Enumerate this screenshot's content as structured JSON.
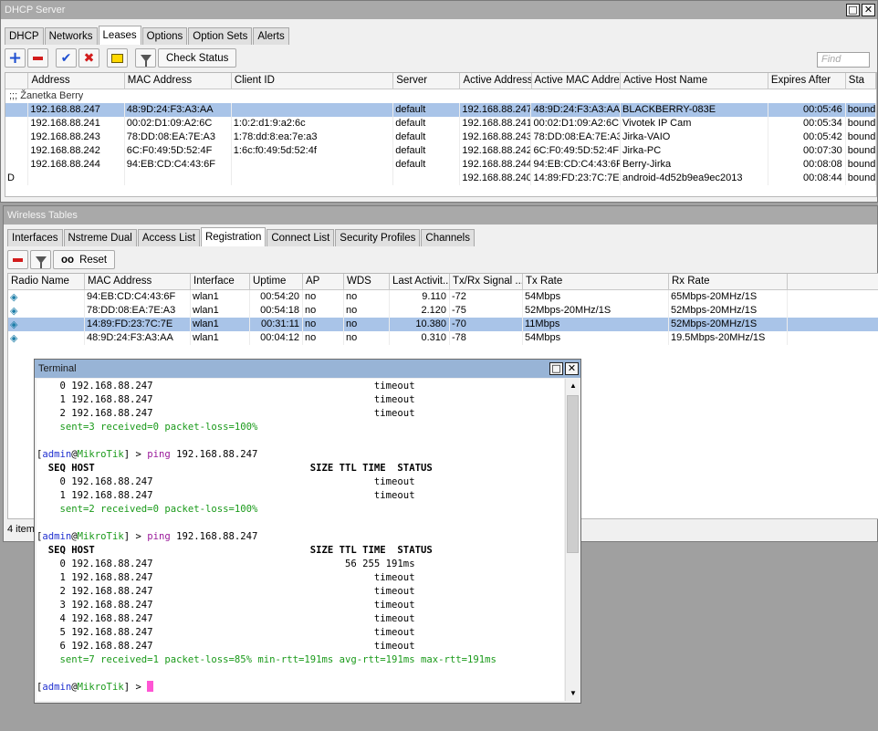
{
  "dhcp": {
    "title": "DHCP Server",
    "tabs": [
      "DHCP",
      "Networks",
      "Leases",
      "Options",
      "Option Sets",
      "Alerts"
    ],
    "selected_tab": "Leases",
    "check_status_label": "Check Status",
    "find_placeholder": "Find",
    "columns": [
      "Address",
      "MAC Address",
      "Client ID",
      "Server",
      "Active Address",
      "Active MAC Addre...",
      "Active Host Name",
      "Expires After",
      "Sta"
    ],
    "group_label": ";;; Žanetka Berry",
    "rows": [
      {
        "flag": "",
        "address": "192.168.88.247",
        "mac": "48:9D:24:F3:A3:AA",
        "client_id": "",
        "server": "default",
        "active_address": "192.168.88.247",
        "active_mac": "48:9D:24:F3:A3:AA",
        "host": "BLACKBERRY-083E",
        "expires": "00:05:46",
        "status": "bound",
        "selected": true
      },
      {
        "flag": "",
        "address": "192.168.88.241",
        "mac": "00:02:D1:09:A2:6C",
        "client_id": "1:0:2:d1:9:a2:6c",
        "server": "default",
        "active_address": "192.168.88.241",
        "active_mac": "00:02:D1:09:A2:6C",
        "host": "Vivotek IP Cam",
        "expires": "00:05:34",
        "status": "bound",
        "selected": false
      },
      {
        "flag": "",
        "address": "192.168.88.243",
        "mac": "78:DD:08:EA:7E:A3",
        "client_id": "1:78:dd:8:ea:7e:a3",
        "server": "default",
        "active_address": "192.168.88.243",
        "active_mac": "78:DD:08:EA:7E:A3",
        "host": "Jirka-VAIO",
        "expires": "00:05:42",
        "status": "bound",
        "selected": false
      },
      {
        "flag": "",
        "address": "192.168.88.242",
        "mac": "6C:F0:49:5D:52:4F",
        "client_id": "1:6c:f0:49:5d:52:4f",
        "server": "default",
        "active_address": "192.168.88.242",
        "active_mac": "6C:F0:49:5D:52:4F",
        "host": "Jirka-PC",
        "expires": "00:07:30",
        "status": "bound",
        "selected": false
      },
      {
        "flag": "",
        "address": "192.168.88.244",
        "mac": "94:EB:CD:C4:43:6F",
        "client_id": "",
        "server": "default",
        "active_address": "192.168.88.244",
        "active_mac": "94:EB:CD:C4:43:6F",
        "host": "Berry-Jirka",
        "expires": "00:08:08",
        "status": "bound",
        "selected": false
      },
      {
        "flag": "D",
        "address": "",
        "mac": "",
        "client_id": "",
        "server": "",
        "active_address": "192.168.88.240",
        "active_mac": "14:89:FD:23:7C:7E",
        "host": "android-4d52b9ea9ec2013",
        "expires": "00:08:44",
        "status": "bound",
        "selected": false
      }
    ]
  },
  "wireless": {
    "title": "Wireless Tables",
    "tabs": [
      "Interfaces",
      "Nstreme Dual",
      "Access List",
      "Registration",
      "Connect List",
      "Security Profiles",
      "Channels"
    ],
    "selected_tab": "Registration",
    "reset_label": "Reset",
    "columns": [
      "Radio Name",
      "MAC Address",
      "Interface",
      "Uptime",
      "AP",
      "WDS",
      "Last Activit...",
      "Tx/Rx Signal ...",
      "Tx Rate",
      "Rx Rate"
    ],
    "rows": [
      {
        "mac": "94:EB:CD:C4:43:6F",
        "iface": "wlan1",
        "uptime": "00:54:20",
        "ap": "no",
        "wds": "no",
        "last": "9.110",
        "signal": "-72",
        "tx": "54Mbps",
        "rx": "65Mbps-20MHz/1S",
        "selected": false
      },
      {
        "mac": "78:DD:08:EA:7E:A3",
        "iface": "wlan1",
        "uptime": "00:54:18",
        "ap": "no",
        "wds": "no",
        "last": "2.120",
        "signal": "-75",
        "tx": "52Mbps-20MHz/1S",
        "rx": "52Mbps-20MHz/1S",
        "selected": false
      },
      {
        "mac": "14:89:FD:23:7C:7E",
        "iface": "wlan1",
        "uptime": "00:31:11",
        "ap": "no",
        "wds": "no",
        "last": "10.380",
        "signal": "-70",
        "tx": "11Mbps",
        "rx": "52Mbps-20MHz/1S",
        "selected": true
      },
      {
        "mac": "48:9D:24:F3:A3:AA",
        "iface": "wlan1",
        "uptime": "00:04:12",
        "ap": "no",
        "wds": "no",
        "last": "0.310",
        "signal": "-78",
        "tx": "54Mbps",
        "rx": "19.5Mbps-20MHz/1S",
        "selected": false
      }
    ],
    "status_text": "4 item"
  },
  "terminal": {
    "title": "Terminal",
    "lines": [
      [
        {
          "t": "    0 192.168.88.247                                      timeout"
        }
      ],
      [
        {
          "t": "    1 192.168.88.247                                      timeout"
        }
      ],
      [
        {
          "t": "    2 192.168.88.247                                      timeout"
        }
      ],
      [
        {
          "t": "    "
        },
        {
          "t": "sent=3 received=0 packet-loss=100%",
          "c": "green"
        }
      ],
      [
        {
          "t": ""
        }
      ],
      [
        {
          "t": "["
        },
        {
          "t": "admin",
          "c": "blue"
        },
        {
          "t": "@"
        },
        {
          "t": "MikroTik",
          "c": "green"
        },
        {
          "t": "] > "
        },
        {
          "t": "ping",
          "c": "purple"
        },
        {
          "t": " 192.168.88.247"
        }
      ],
      [
        {
          "t": "  SEQ HOST                                     SIZE TTL TIME  STATUS",
          "c": "bold"
        }
      ],
      [
        {
          "t": "    0 192.168.88.247                                      timeout"
        }
      ],
      [
        {
          "t": "    1 192.168.88.247                                      timeout"
        }
      ],
      [
        {
          "t": "    "
        },
        {
          "t": "sent=2 received=0 packet-loss=100%",
          "c": "green"
        }
      ],
      [
        {
          "t": ""
        }
      ],
      [
        {
          "t": "["
        },
        {
          "t": "admin",
          "c": "blue"
        },
        {
          "t": "@"
        },
        {
          "t": "MikroTik",
          "c": "green"
        },
        {
          "t": "] > "
        },
        {
          "t": "ping",
          "c": "purple"
        },
        {
          "t": " 192.168.88.247"
        }
      ],
      [
        {
          "t": "  SEQ HOST                                     SIZE TTL TIME  STATUS",
          "c": "bold"
        }
      ],
      [
        {
          "t": "    0 192.168.88.247                                 56 255 191ms"
        }
      ],
      [
        {
          "t": "    1 192.168.88.247                                      timeout"
        }
      ],
      [
        {
          "t": "    2 192.168.88.247                                      timeout"
        }
      ],
      [
        {
          "t": "    3 192.168.88.247                                      timeout"
        }
      ],
      [
        {
          "t": "    4 192.168.88.247                                      timeout"
        }
      ],
      [
        {
          "t": "    5 192.168.88.247                                      timeout"
        }
      ],
      [
        {
          "t": "    6 192.168.88.247                                      timeout"
        }
      ],
      [
        {
          "t": "    "
        },
        {
          "t": "sent=7 received=1 packet-loss=85% min-rtt=191ms avg-rtt=191ms max-rtt=191ms",
          "c": "green"
        }
      ],
      [
        {
          "t": ""
        }
      ],
      [
        {
          "t": "["
        },
        {
          "t": "admin",
          "c": "blue"
        },
        {
          "t": "@"
        },
        {
          "t": "MikroTik",
          "c": "green"
        },
        {
          "t": "] > "
        },
        {
          "cursor": true
        }
      ]
    ]
  },
  "colors": {
    "selected_row": "#a9c4e8",
    "cursor": "#ff55d4",
    "prompt_user": "#2030d0",
    "prompt_host": "#1a9a1a"
  }
}
